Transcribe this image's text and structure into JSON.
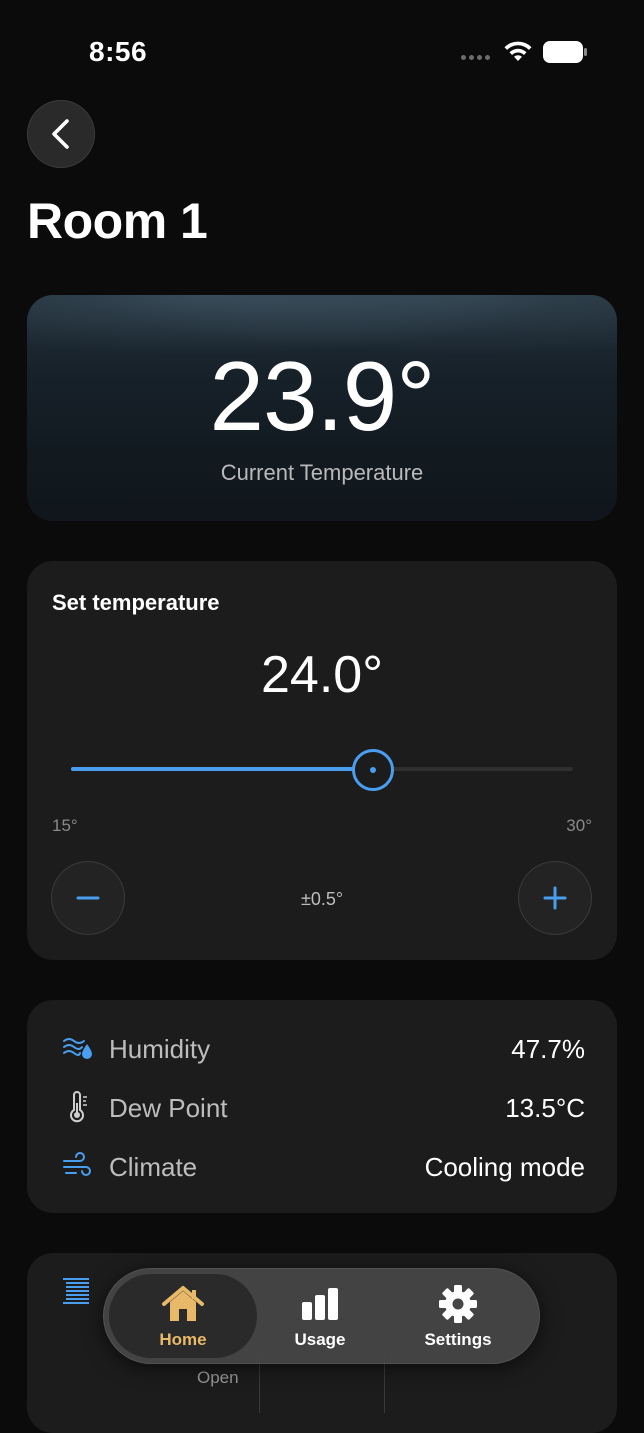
{
  "status_bar": {
    "time": "8:56"
  },
  "header": {
    "title": "Room 1"
  },
  "current": {
    "value": "23.9°",
    "label": "Current Temperature"
  },
  "set_temperature": {
    "title": "Set temperature",
    "value": "24.0°",
    "min_label": "15°",
    "max_label": "30°",
    "slider_fraction": 0.6,
    "step_label": "±0.5°",
    "accent": "#4a9ef0"
  },
  "info": {
    "rows": [
      {
        "icon": "humidity-icon",
        "label": "Humidity",
        "value": "47.7%"
      },
      {
        "icon": "thermometer-icon",
        "label": "Dew Point",
        "value": "13.5°C"
      },
      {
        "icon": "wind-icon",
        "label": "Climate",
        "value": "Cooling mode"
      }
    ]
  },
  "next_card": {
    "open_label": "Open"
  },
  "tabs": [
    {
      "label": "Home",
      "icon": "home-icon",
      "active": true,
      "color": "#e8b968"
    },
    {
      "label": "Usage",
      "icon": "bar-chart-icon",
      "active": false
    },
    {
      "label": "Settings",
      "icon": "gear-icon",
      "active": false
    }
  ]
}
